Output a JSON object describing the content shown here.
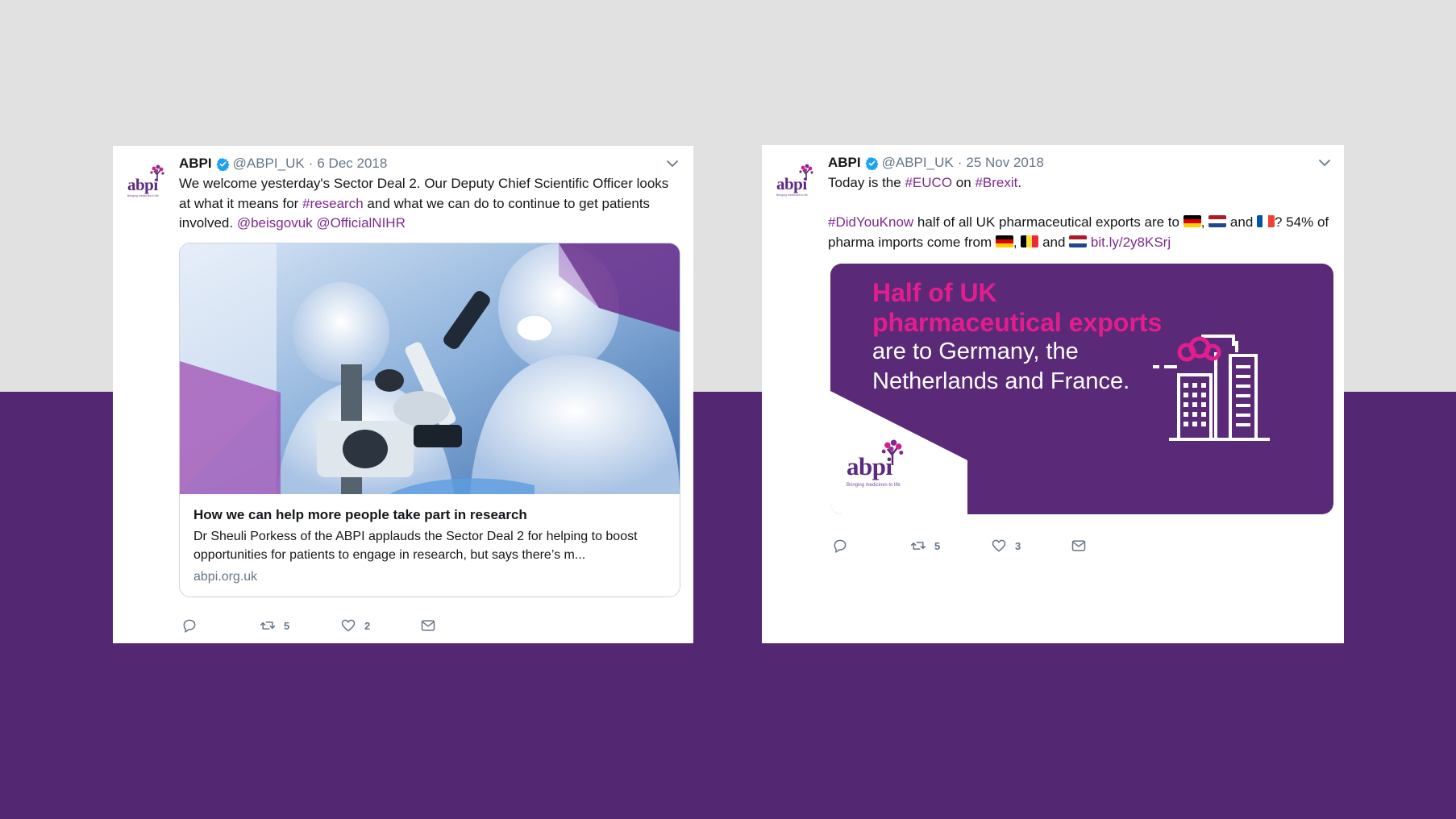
{
  "tweets": [
    {
      "author": "ABPI",
      "handle": "@ABPI_UK",
      "date": "6 Dec 2018",
      "text_part1": "We welcome yesterday's Sector Deal 2. Our Deputy Chief Scientific Officer looks at what it means for",
      "hashtag_research": "#research",
      "text_part2": "and what we can do to continue to get patients involved.",
      "mention_beis": "@beisgovuk",
      "mention_nihr": "@OfficialNIHR",
      "card": {
        "title": "How we can help more people take part in research",
        "description": "Dr Sheuli Porkess of the ABPI applauds the Sector Deal 2 for helping to boost opportunities for patients to engage in research, but says there’s m...",
        "url": "abpi.org.uk"
      },
      "retweets": "5",
      "likes": "2"
    },
    {
      "author": "ABPI",
      "handle": "@ABPI_UK",
      "date": "25 Nov 2018",
      "line1_a": "Today is the",
      "hashtag_euco": "#EUCO",
      "line1_b": "on",
      "hashtag_brexit": "#Brexit",
      "line1_c": ".",
      "hashtag_didyouknow": "#DidYouKnow",
      "line2_a": "half of all UK pharmaceutical exports are to",
      "comma": ",",
      "and": "and",
      "line2_b": "? 54% of pharma imports come from",
      "link": "bit.ly/2y8KSrj",
      "promo": {
        "headline_1": "Half of UK",
        "headline_2": "pharmaceutical exports",
        "body_1": "are to Germany, the",
        "body_2": "Netherlands and France."
      },
      "retweets": "5",
      "likes": "3"
    }
  ],
  "logo": {
    "word": "abpi",
    "tagline": "Bringing medicines to life"
  },
  "colors": {
    "background_top": "#e1e1e1",
    "background_bottom": "#542773",
    "hashtag": "#7d2a8e",
    "promo_bg": "#5a2a78",
    "promo_accent": "#e21d8d",
    "verified": "#1da1f2"
  },
  "icons": [
    "verified-badge-icon",
    "chevron-down-icon",
    "reply-icon",
    "retweet-icon",
    "like-icon",
    "direct-message-icon"
  ]
}
